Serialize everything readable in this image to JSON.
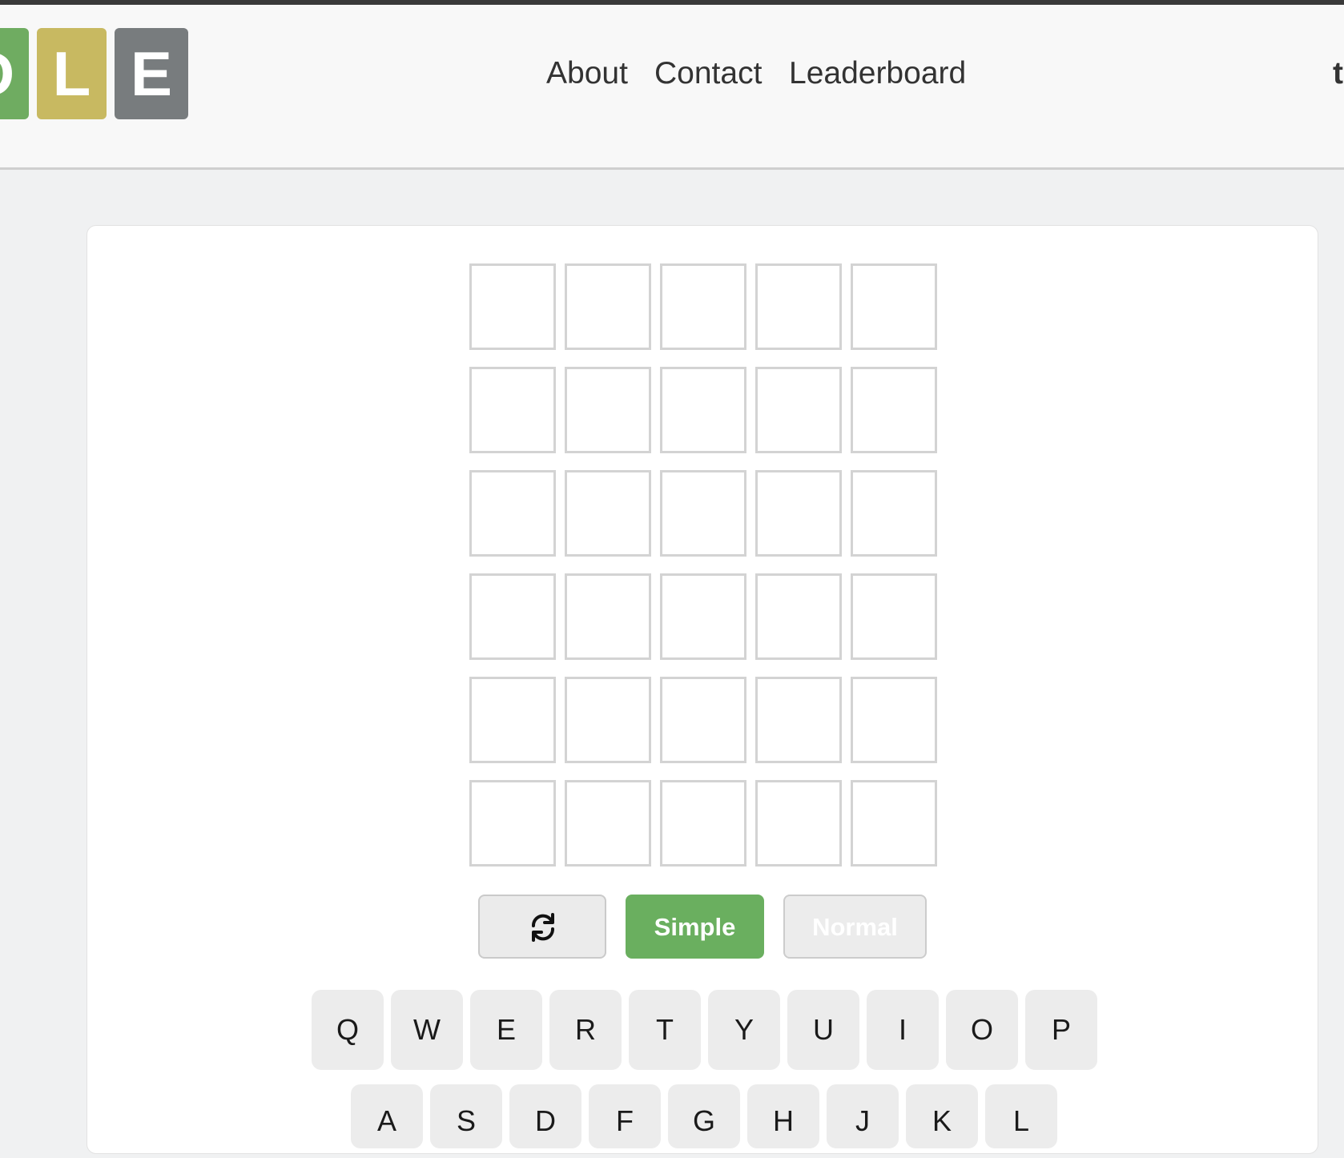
{
  "header": {
    "logo_letters": [
      "D",
      "L",
      "E"
    ],
    "nav": [
      "About",
      "Contact",
      "Leaderboard"
    ],
    "edge_text": "t"
  },
  "board": {
    "rows": [
      [
        "",
        "",
        "",
        "",
        ""
      ],
      [
        "",
        "",
        "",
        "",
        ""
      ],
      [
        "",
        "",
        "",
        "",
        ""
      ],
      [
        "",
        "",
        "",
        "",
        ""
      ],
      [
        "",
        "",
        "",
        "",
        ""
      ],
      [
        "",
        "",
        "",
        "",
        ""
      ]
    ]
  },
  "controls": {
    "refresh_icon": "refresh-icon",
    "simple_label": "Simple",
    "normal_label": "Normal",
    "simple_color": "#6aaf5f"
  },
  "keyboard": {
    "row1": [
      "Q",
      "W",
      "E",
      "R",
      "T",
      "Y",
      "U",
      "I",
      "O",
      "P"
    ],
    "row2": [
      "A",
      "S",
      "D",
      "F",
      "G",
      "H",
      "J",
      "K",
      "L"
    ]
  },
  "colors": {
    "green": "#6fac61",
    "yellow": "#c8b961",
    "gray": "#787c7e"
  }
}
